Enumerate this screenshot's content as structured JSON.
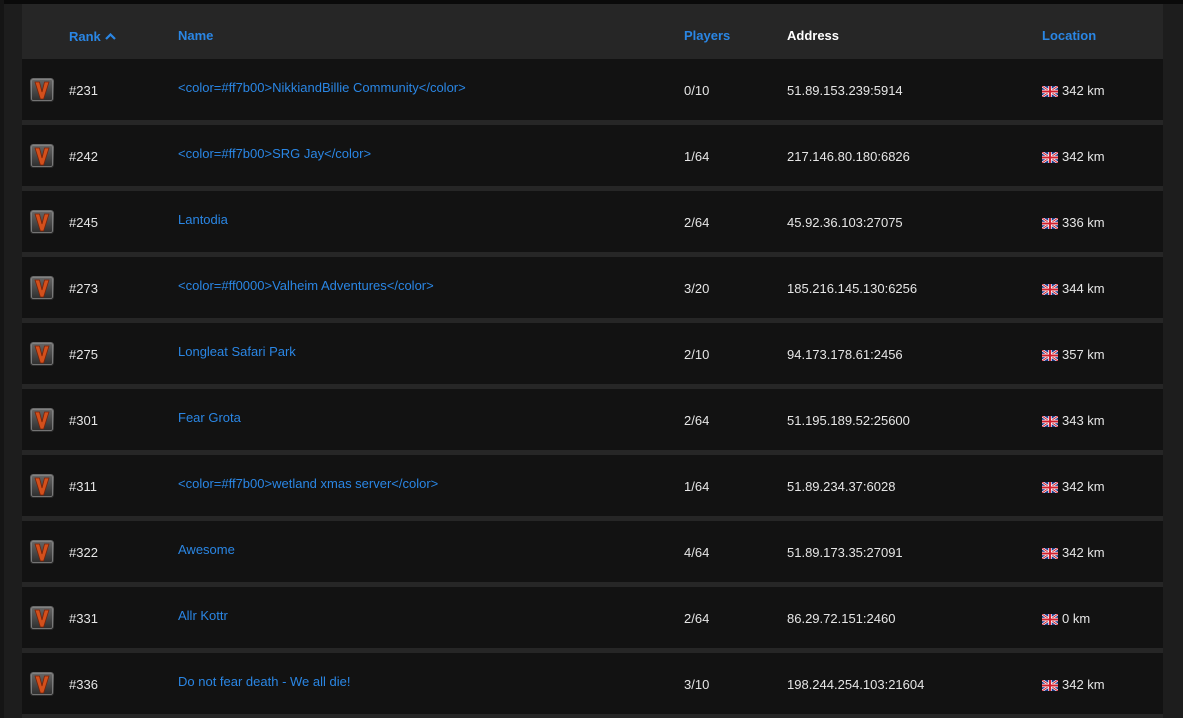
{
  "header": {
    "rank": "Rank",
    "name": "Name",
    "players": "Players",
    "address": "Address",
    "location": "Location",
    "sort_icon": "chevron-up-icon"
  },
  "colors": {
    "link": "#2a86e4",
    "row_bg": "#121212",
    "panel_bg": "#262626"
  },
  "rows": [
    {
      "rank": "#231",
      "name": "<color=#ff7b00>NikkiandBillie Community</color>",
      "players": "0/10",
      "address": "51.89.153.239:5914",
      "distance": "342 km",
      "flag": "uk-flag-icon"
    },
    {
      "rank": "#242",
      "name": "<color=#ff7b00>SRG Jay</color>",
      "players": "1/64",
      "address": "217.146.80.180:6826",
      "distance": "342 km",
      "flag": "uk-flag-icon"
    },
    {
      "rank": "#245",
      "name": "Lantodia",
      "players": "2/64",
      "address": "45.92.36.103:27075",
      "distance": "336 km",
      "flag": "uk-flag-icon"
    },
    {
      "rank": "#273",
      "name": "<color=#ff0000>Valheim Adventures</color>",
      "players": "3/20",
      "address": "185.216.145.130:6256",
      "distance": "344 km",
      "flag": "uk-flag-icon"
    },
    {
      "rank": "#275",
      "name": "Longleat Safari Park",
      "players": "2/10",
      "address": "94.173.178.61:2456",
      "distance": "357 km",
      "flag": "uk-flag-icon"
    },
    {
      "rank": "#301",
      "name": "Fear Grota",
      "players": "2/64",
      "address": "51.195.189.52:25600",
      "distance": "343 km",
      "flag": "uk-flag-icon"
    },
    {
      "rank": "#311",
      "name": "<color=#ff7b00>wetland xmas server</color>",
      "players": "1/64",
      "address": "51.89.234.37:6028",
      "distance": "342 km",
      "flag": "uk-flag-icon"
    },
    {
      "rank": "#322",
      "name": "Awesome",
      "players": "4/64",
      "address": "51.89.173.35:27091",
      "distance": "342 km",
      "flag": "uk-flag-icon"
    },
    {
      "rank": "#331",
      "name": "Allr Kottr",
      "players": "2/64",
      "address": "86.29.72.151:2460",
      "distance": "0 km",
      "flag": "uk-flag-icon"
    },
    {
      "rank": "#336",
      "name": "Do not fear death - We all die!",
      "players": "3/10",
      "address": "198.244.254.103:21604",
      "distance": "342 km",
      "flag": "uk-flag-icon"
    }
  ]
}
